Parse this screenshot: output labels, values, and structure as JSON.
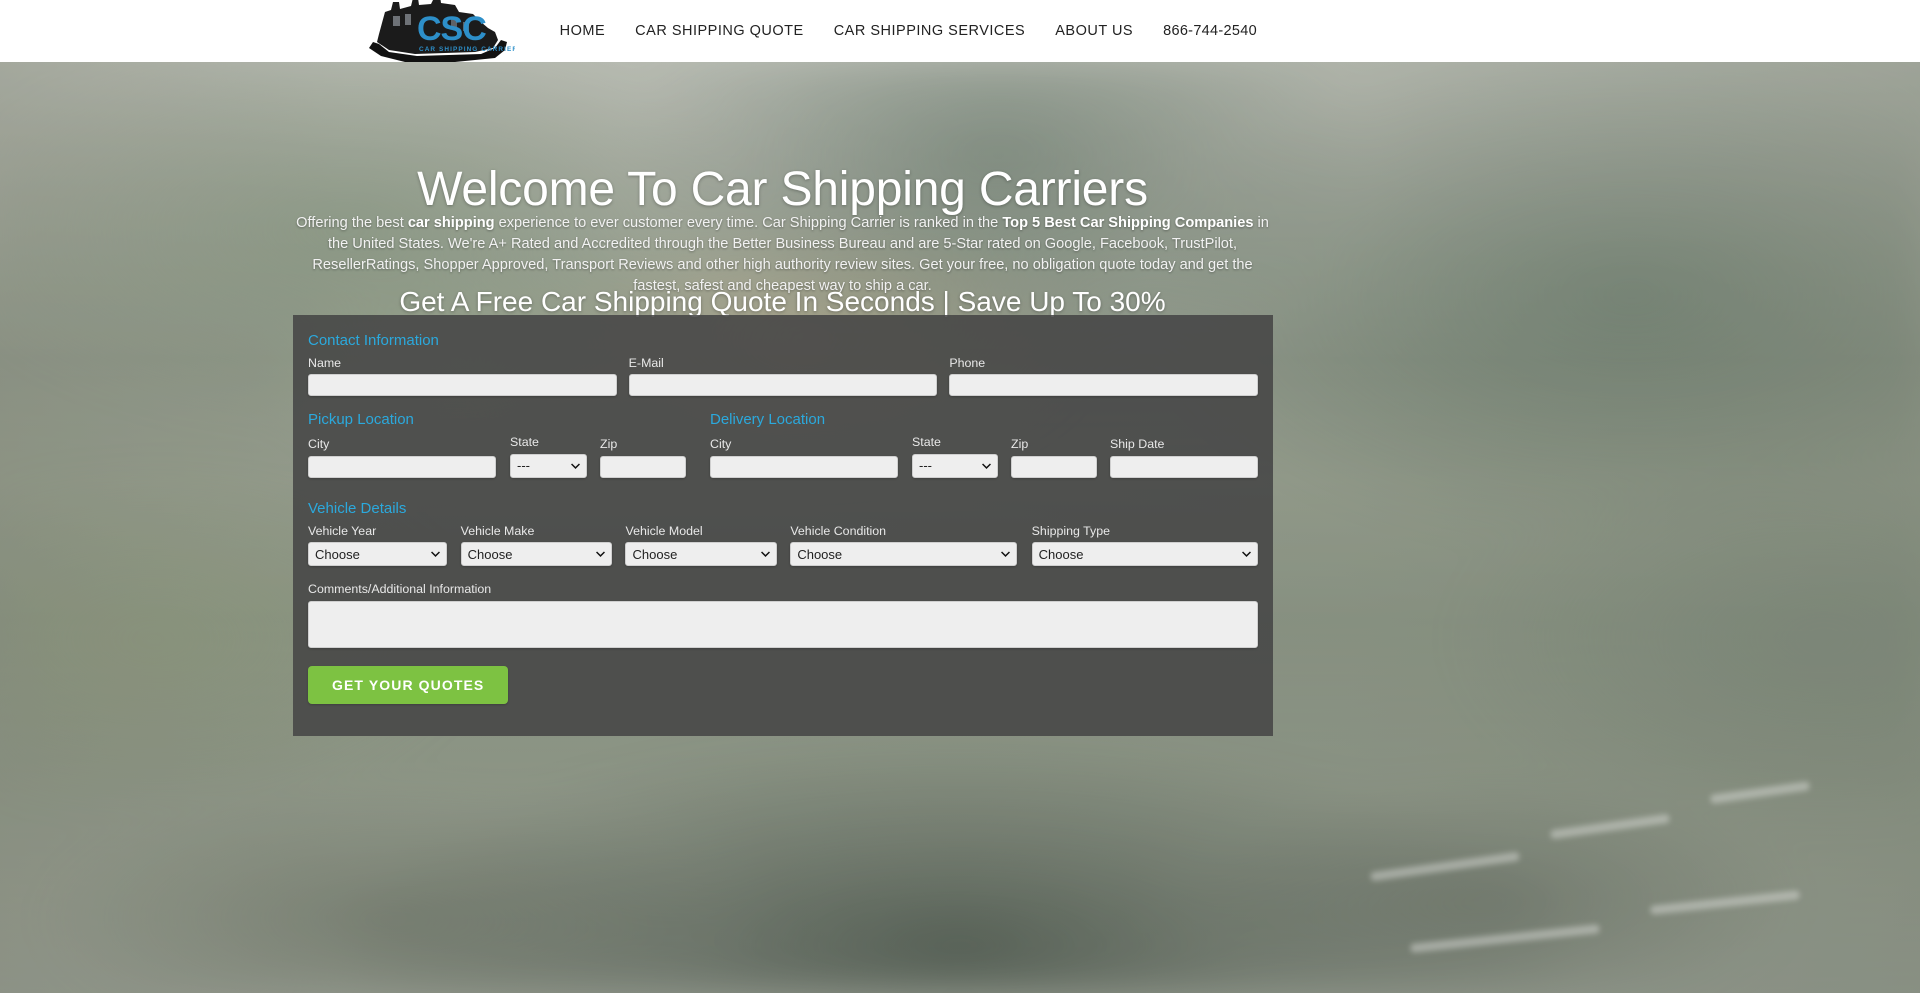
{
  "header": {
    "logo": {
      "name": "csc-logo",
      "initials": "CSC",
      "tagline": "CAR SHIPPING CARRIERS",
      "color": "#2d8fc9"
    },
    "nav": [
      {
        "label": "HOME",
        "name": "nav-item-home"
      },
      {
        "label": "CAR SHIPPING QUOTE",
        "name": "nav-item-car-shipping-quote"
      },
      {
        "label": "CAR SHIPPING SERVICES",
        "name": "nav-item-car-shipping-services"
      },
      {
        "label": "ABOUT US",
        "name": "nav-item-about-us"
      },
      {
        "label": "866-744-2540",
        "name": "nav-item-phone"
      }
    ]
  },
  "hero": {
    "title": "Welcome To Car Shipping Carriers",
    "paragraph": {
      "part1": "Offering the best ",
      "bold1": "car shipping",
      "part2": " experience to ever customer every time.  Car Shipping Carrier is ranked in the ",
      "bold2": "Top 5 Best Car Shipping Companies",
      "part3": " in the United States.  We're A+ Rated and Accredited through the Better Business Bureau and are 5-Star rated on Google, Facebook, TrustPilot, ResellerRatings, Shopper Approved, Transport Reviews and other high authority review sites.  Get your free, no obligation quote today and get the fastest, safest and cheapest way to ship a car."
    },
    "subtitle": "Get A Free Car Shipping Quote In Seconds | Save Up To 30%"
  },
  "form": {
    "sections": {
      "contact": "Contact Information",
      "pickup": "Pickup Location",
      "delivery": "Delivery Location",
      "vehicle": "Vehicle Details"
    },
    "accent_color": "#2ba9dd",
    "panel_color": "#464646",
    "contact_fields": [
      {
        "label": "Name",
        "value": "",
        "placeholder": "",
        "name": "name-input"
      },
      {
        "label": "E-Mail",
        "value": "",
        "placeholder": "",
        "name": "email-input"
      },
      {
        "label": "Phone",
        "value": "",
        "placeholder": "",
        "name": "phone-input"
      }
    ],
    "pickup_fields": {
      "city": {
        "label": "City",
        "value": "",
        "name": "pickup-city-input"
      },
      "state": {
        "label": "State",
        "value": "---",
        "options": [
          "---"
        ],
        "name": "pickup-state-select"
      },
      "zip": {
        "label": "Zip",
        "value": "",
        "name": "pickup-zip-input"
      }
    },
    "delivery_fields": {
      "city": {
        "label": "City",
        "value": "",
        "name": "delivery-city-input"
      },
      "state": {
        "label": "State",
        "value": "---",
        "options": [
          "---"
        ],
        "name": "delivery-state-select"
      },
      "zip": {
        "label": "Zip",
        "value": "",
        "name": "delivery-zip-input"
      },
      "ship_date": {
        "label": "Ship Date",
        "value": "",
        "name": "ship-date-input"
      }
    },
    "vehicle_fields": [
      {
        "label": "Vehicle Year",
        "value": "Choose",
        "name": "vehicle-year-select"
      },
      {
        "label": "Vehicle Make",
        "value": "Choose",
        "name": "vehicle-make-select"
      },
      {
        "label": "Vehicle Model",
        "value": "Choose",
        "name": "vehicle-model-select"
      },
      {
        "label": "Vehicle Condition",
        "value": "Choose",
        "name": "vehicle-condition-select"
      },
      {
        "label": "Shipping Type",
        "value": "Choose",
        "name": "shipping-type-select"
      }
    ],
    "comments": {
      "label": "Comments/Additional Information",
      "value": "",
      "name": "comments-textarea"
    },
    "submit": {
      "label": "Get Your Quotes",
      "color": "#7dc242",
      "name": "get-your-quotes-button"
    }
  }
}
